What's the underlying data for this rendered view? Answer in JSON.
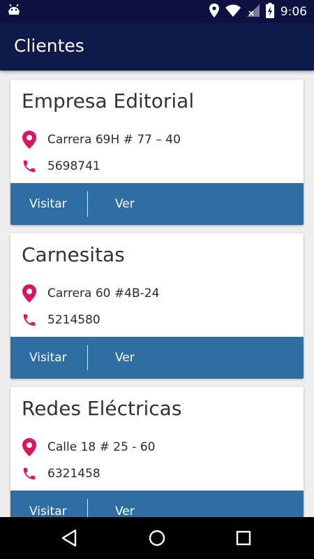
{
  "status_bar": {
    "time": "9:06",
    "icons": [
      "android-debug-icon",
      "location-icon",
      "wifi-icon",
      "signal-icon",
      "battery-charging-icon"
    ]
  },
  "app_bar": {
    "title": "Clientes"
  },
  "clients": [
    {
      "name": "Empresa Editorial",
      "address": "Carrera 69H # 77 – 40",
      "phone": "5698741",
      "visit_label": "Visitar",
      "view_label": "Ver"
    },
    {
      "name": "Carnesitas",
      "address": "Carrera 60 #4B-24",
      "phone": "5214580",
      "visit_label": "Visitar",
      "view_label": "Ver"
    },
    {
      "name": "Redes Eléctricas",
      "address": "Calle 18 # 25 - 60",
      "phone": "6321458",
      "visit_label": "Visitar",
      "view_label": "Ver"
    }
  ],
  "nav_bar": {
    "icons": [
      "back-icon",
      "home-icon",
      "recents-icon"
    ]
  },
  "colors": {
    "status_bar": "#0b1240",
    "app_bar": "#0f1a4a",
    "card_action_bar": "#2f6da3",
    "icon_accent": "#e0115f",
    "background": "#eeeeee"
  }
}
